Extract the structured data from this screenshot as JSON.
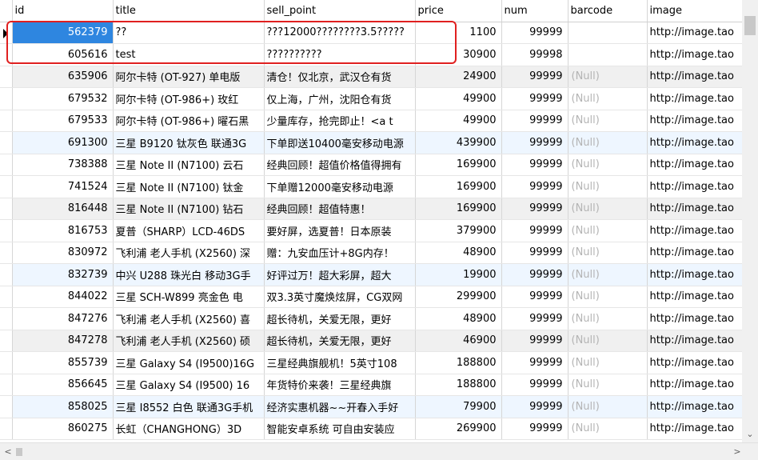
{
  "columns": [
    "id",
    "title",
    "sell_point",
    "price",
    "num",
    "barcode",
    "image"
  ],
  "null_label": "(Null)",
  "rows": [
    {
      "id": "562379",
      "title": "??",
      "sell_point": "???12000????????3.5?????",
      "price": "1100",
      "num": "99999",
      "barcode": "",
      "image": "http://image.tao"
    },
    {
      "id": "605616",
      "title": "test",
      "sell_point": "??????????",
      "price": "30900",
      "num": "99998",
      "barcode": "",
      "image": "http://image.tao"
    },
    {
      "id": "635906",
      "title": "阿尔卡特 (OT-927) 单电版",
      "sell_point": "清仓！仅北京，武汉仓有货",
      "price": "24900",
      "num": "99999",
      "barcode": null,
      "image": "http://image.tao"
    },
    {
      "id": "679532",
      "title": "阿尔卡特 (OT-986+) 玫红",
      "sell_point": "仅上海，广州，沈阳仓有货",
      "price": "49900",
      "num": "99999",
      "barcode": null,
      "image": "http://image.tao"
    },
    {
      "id": "679533",
      "title": "阿尔卡特 (OT-986+) 曜石黑",
      "sell_point": "少量库存，抢完即止！<a t",
      "price": "49900",
      "num": "99999",
      "barcode": null,
      "image": "http://image.tao"
    },
    {
      "id": "691300",
      "title": "三星 B9120 钛灰色 联通3G",
      "sell_point": "下单即送10400毫安移动电源",
      "price": "439900",
      "num": "99999",
      "barcode": null,
      "image": "http://image.tao"
    },
    {
      "id": "738388",
      "title": "三星 Note II (N7100) 云石",
      "sell_point": "经典回顾！超值价格值得拥有",
      "price": "169900",
      "num": "99999",
      "barcode": null,
      "image": "http://image.tao"
    },
    {
      "id": "741524",
      "title": "三星 Note II (N7100) 钛金",
      "sell_point": "下单赠12000毫安移动电源",
      "price": "169900",
      "num": "99999",
      "barcode": null,
      "image": "http://image.tao"
    },
    {
      "id": "816448",
      "title": "三星 Note II (N7100) 钻石",
      "sell_point": "经典回顾！超值特惠！",
      "price": "169900",
      "num": "99999",
      "barcode": null,
      "image": "http://image.tao"
    },
    {
      "id": "816753",
      "title": "夏普（SHARP）LCD-46DS",
      "sell_point": "要好屏，选夏普！日本原装",
      "price": "379900",
      "num": "99999",
      "barcode": null,
      "image": "http://image.tao"
    },
    {
      "id": "830972",
      "title": "飞利浦 老人手机 (X2560) 深",
      "sell_point": "赠：九安血压计+8G内存！",
      "price": "48900",
      "num": "99999",
      "barcode": null,
      "image": "http://image.tao"
    },
    {
      "id": "832739",
      "title": "中兴 U288 珠光白 移动3G手",
      "sell_point": "好评过万！超大彩屏，超大",
      "price": "19900",
      "num": "99999",
      "barcode": null,
      "image": "http://image.tao"
    },
    {
      "id": "844022",
      "title": "三星 SCH-W899 亮金色 电",
      "sell_point": "双3.3英寸魔焕炫屏，CG双网",
      "price": "299900",
      "num": "99999",
      "barcode": null,
      "image": "http://image.tao"
    },
    {
      "id": "847276",
      "title": "飞利浦 老人手机 (X2560) 喜",
      "sell_point": "超长待机，关爱无限，更好",
      "price": "48900",
      "num": "99999",
      "barcode": null,
      "image": "http://image.tao"
    },
    {
      "id": "847278",
      "title": "飞利浦 老人手机 (X2560) 硕",
      "sell_point": "超长待机，关爱无限，更好",
      "price": "46900",
      "num": "99999",
      "barcode": null,
      "image": "http://image.tao"
    },
    {
      "id": "855739",
      "title": "三星 Galaxy S4 (I9500)16G",
      "sell_point": "三星经典旗舰机！5英寸108",
      "price": "188800",
      "num": "99999",
      "barcode": null,
      "image": "http://image.tao"
    },
    {
      "id": "856645",
      "title": "三星 Galaxy S4 (I9500) 16",
      "sell_point": "年货特价来袭！三星经典旗",
      "price": "188800",
      "num": "99999",
      "barcode": null,
      "image": "http://image.tao"
    },
    {
      "id": "858025",
      "title": "三星 I8552 白色 联通3G手机",
      "sell_point": "经济实惠机器~~开春入手好",
      "price": "79900",
      "num": "99999",
      "barcode": null,
      "image": "http://image.tao"
    },
    {
      "id": "860275",
      "title": "长虹（CHANGHONG）3D",
      "sell_point": "智能安卓系统 可自由安装应",
      "price": "269900",
      "num": "99999",
      "barcode": null,
      "image": "http://image.tao"
    }
  ],
  "icons": {
    "row_indicator": "right-triangle",
    "scroll_down": "chevron-down",
    "scroll_left": "chevron-left",
    "scroll_right": "chevron-right"
  },
  "colors": {
    "selection": "#2e86e0",
    "highlight_box": "#e02020",
    "null_text": "#b4b4b4",
    "alt_row": "#f0f0f0",
    "blue_row": "#eef6ff"
  }
}
